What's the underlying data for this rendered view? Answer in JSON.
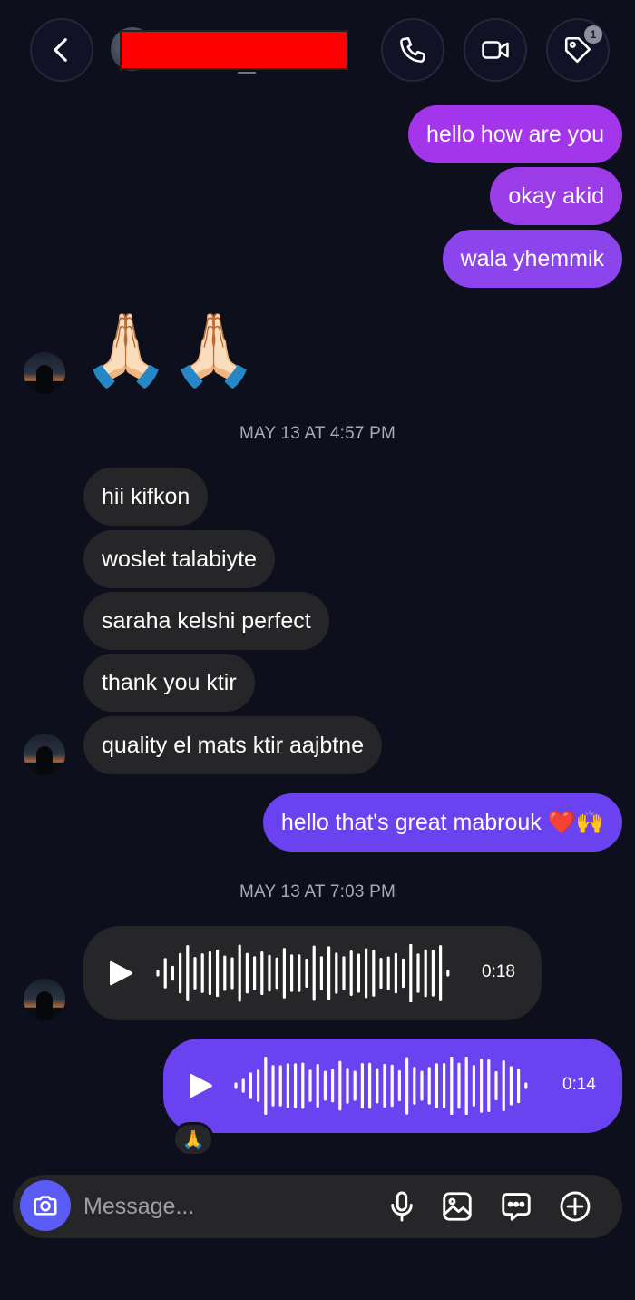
{
  "header": {
    "back_icon": "chevron-left-icon",
    "call_icon": "phone-icon",
    "video_icon": "video-camera-icon",
    "tag_icon": "tag-icon",
    "tag_badge": "1"
  },
  "messages": {
    "out1": "hello how are you",
    "out2": "okay akid",
    "out3": "wala yhemmik",
    "emoji_reply": "🙏🏻🙏🏻",
    "timestamp1": "MAY 13 AT 4:57 PM",
    "in1": "hii kifkon",
    "in2": "woslet talabiyte",
    "in3": "saraha kelshi perfect",
    "in4": "thank you ktir",
    "in5": "quality el mats ktir aajbtne",
    "out4": "hello that's great mabrouk ❤️🙌",
    "timestamp2": "MAY 13 AT 7:03 PM"
  },
  "voice_in": {
    "duration": "0:18"
  },
  "voice_out": {
    "duration": "0:14",
    "reaction": "🙏"
  },
  "composer": {
    "placeholder": "Message...",
    "icons": [
      "camera-icon",
      "microphone-icon",
      "gallery-icon",
      "sticker-icon",
      "plus-icon"
    ]
  },
  "colors": {
    "background": "#0e0f1d",
    "incoming_bubble": "#262628",
    "outgoing_purple": "#a335ea",
    "outgoing_blue": "#6a42f0",
    "camera_button": "#5a5cf5"
  }
}
